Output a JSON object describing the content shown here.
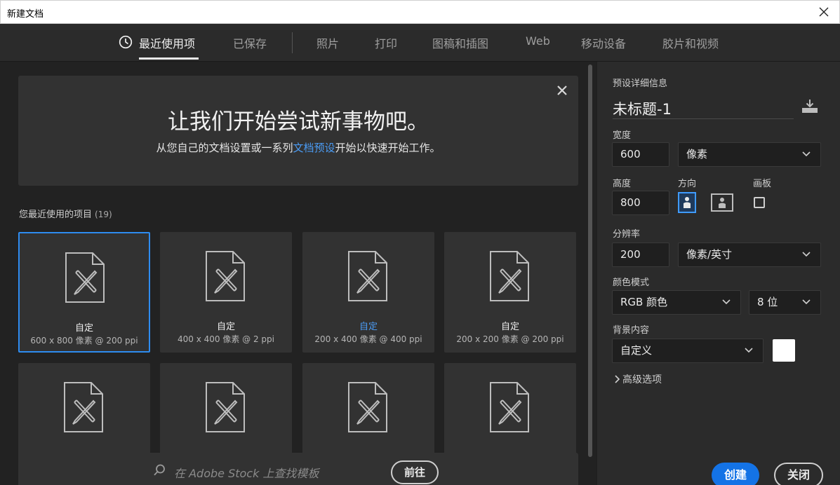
{
  "window": {
    "title": "新建文档"
  },
  "tabs": [
    {
      "label": "最近使用项",
      "active": true
    },
    {
      "label": "已保存"
    },
    {
      "label": "照片"
    },
    {
      "label": "打印"
    },
    {
      "label": "图稿和插图"
    },
    {
      "label": "Web"
    },
    {
      "label": "移动设备"
    },
    {
      "label": "胶片和视频"
    }
  ],
  "welcome": {
    "heading": "让我们开始尝试新事物吧。",
    "text_before": "从您自己的文档设置或一系列",
    "link": "文档预设",
    "text_after": "开始以快速开始工作。"
  },
  "recent": {
    "title": "您最近使用的项目",
    "count": "(19)",
    "items": [
      {
        "name": "自定",
        "meta": "600 x 800 像素 @ 200 ppi",
        "selected": true
      },
      {
        "name": "自定",
        "meta": "400 x 400 像素 @ 2 ppi"
      },
      {
        "name": "自定",
        "meta": "200 x 400 像素 @ 400 ppi",
        "highlight": true
      },
      {
        "name": "自定",
        "meta": "200 x 200 像素 @ 200 ppi"
      },
      {
        "name": "",
        "meta": ""
      },
      {
        "name": "",
        "meta": ""
      },
      {
        "name": "",
        "meta": ""
      },
      {
        "name": "",
        "meta": ""
      }
    ]
  },
  "stock": {
    "placeholder": "在 Adobe Stock 上查找模板",
    "go_label": "前往"
  },
  "preset": {
    "section_title": "预设详细信息",
    "name": "未标题-1",
    "width_label": "宽度",
    "width_value": "600",
    "width_unit": "像素",
    "height_label": "高度",
    "height_value": "800",
    "orientation_label": "方向",
    "artboard_label": "画板",
    "resolution_label": "分辨率",
    "resolution_value": "200",
    "resolution_unit": "像素/英寸",
    "color_mode_label": "颜色模式",
    "color_mode": "RGB 颜色",
    "bit_depth": "8 位",
    "background_label": "背景内容",
    "background": "自定义",
    "background_color": "#ffffff",
    "advanced_label": "高级选项",
    "create_label": "创建",
    "close_label": "关闭"
  },
  "colors": {
    "accent": "#1473e6",
    "link": "#4b9cf5",
    "selection": "#2e8cf0"
  },
  "icons": [
    "clock-icon",
    "close-icon",
    "document-icon",
    "search-icon",
    "save-preset-icon",
    "chevron-down-icon",
    "portrait-icon",
    "landscape-icon",
    "checkbox-icon",
    "chevron-right-icon"
  ]
}
